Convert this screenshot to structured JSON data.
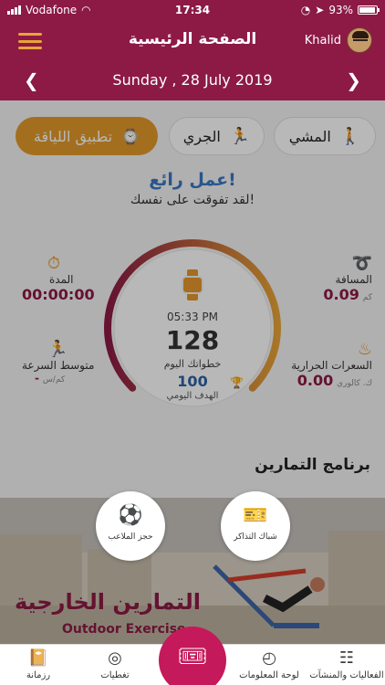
{
  "status_bar": {
    "carrier": "Vodafone",
    "time": "17:34",
    "battery": "93%",
    "battery_level": 0.93
  },
  "header": {
    "title": "الصفحة الرئيسية",
    "user_name": "Khalid"
  },
  "date_bar": {
    "date": "Sunday , 28 July 2019"
  },
  "activity_tabs": [
    {
      "label": "المشي",
      "icon": "walking-icon"
    },
    {
      "label": "الجري",
      "icon": "running-icon"
    },
    {
      "label": "تطبيق اللياقة",
      "icon": "fitness-watch-icon"
    }
  ],
  "message": {
    "headline": "عمل رائع!",
    "subtitle": "لقد تفوقت على نفسك!"
  },
  "gauge": {
    "time": "05:33 PM",
    "steps": "128",
    "steps_label": "خطواتك اليوم",
    "goal": "100",
    "goal_label": "الهدف اليومي",
    "progress": 1.0,
    "colors": {
      "start": "#8c1a45",
      "end": "#e8a436"
    }
  },
  "stats": {
    "distance": {
      "label": "المسافة",
      "value": "0.09",
      "unit": "كم"
    },
    "duration": {
      "label": "المدة",
      "value": "00:00:00"
    },
    "calories": {
      "label": "السعرات الحرارية",
      "value": "0.00",
      "unit": "ك. كالوري"
    },
    "avg_speed": {
      "label": "متوسط السرعة",
      "value": "-",
      "unit": "كم/س"
    }
  },
  "section": {
    "title": "برنامج التمارين"
  },
  "banner": {
    "arabic": "التمارين الخارجية",
    "english": "Outdoor Exercise"
  },
  "quick_actions": [
    {
      "label": "حجز الملاعب",
      "icon": "stadium-icon"
    },
    {
      "label": "شباك التذاكر",
      "icon": "ticket-icon"
    }
  ],
  "tab_bar": [
    {
      "label": "رزمانة",
      "icon": "calendar-icon"
    },
    {
      "label": "تغطيات",
      "icon": "instagram-icon"
    },
    {
      "label": "لوحة المعلومات",
      "icon": "dashboard-icon"
    },
    {
      "label": "الفعاليات والمنشآت",
      "icon": "events-icon"
    }
  ],
  "colors": {
    "brand": "#8c1a45",
    "accent": "#e7962c",
    "fab": "#c4195a",
    "link": "#3a78c2"
  }
}
